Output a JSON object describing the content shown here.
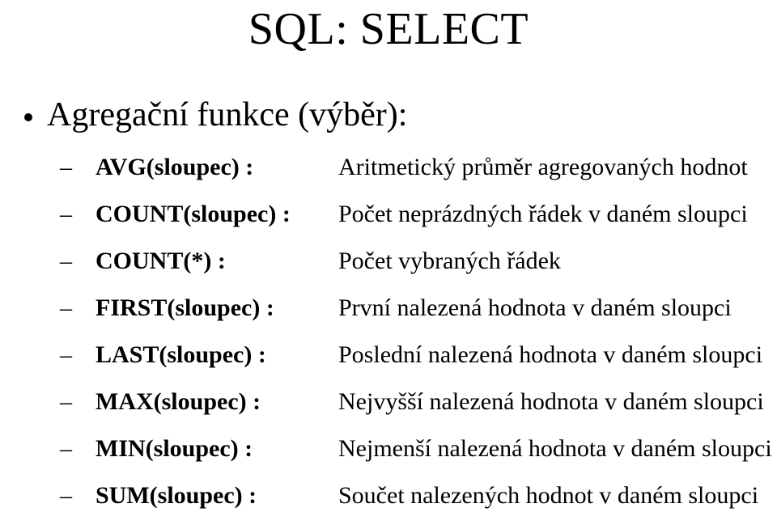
{
  "title": "SQL: SELECT",
  "section": "Agregační funkce (výběr):",
  "dash": "–",
  "items": [
    {
      "fn": "AVG(sloupec) :",
      "desc": "Aritmetický průměr agregovaných hodnot"
    },
    {
      "fn": "COUNT(sloupec) :",
      "desc": "Počet neprázdných řádek v daném sloupci"
    },
    {
      "fn": "COUNT(*) :",
      "desc": "Počet vybraných řádek"
    },
    {
      "fn": "FIRST(sloupec) :",
      "desc": "První nalezená hodnota v daném sloupci"
    },
    {
      "fn": "LAST(sloupec) :",
      "desc": "Poslední nalezená hodnota v daném sloupci"
    },
    {
      "fn": "MAX(sloupec) :",
      "desc": "Nejvyšší nalezená hodnota v daném sloupci"
    },
    {
      "fn": "MIN(sloupec) :",
      "desc": "Nejmenší nalezená hodnota v daném sloupci"
    },
    {
      "fn": "SUM(sloupec) :",
      "desc": "Součet nalezených hodnot v daném sloupci"
    }
  ]
}
